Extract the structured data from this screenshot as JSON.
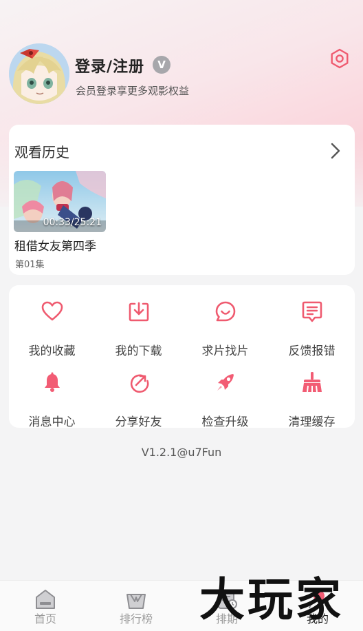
{
  "profile": {
    "user_name": "登录/注册",
    "vip_badge": "V",
    "subtitle": "会员登录享更多观影权益"
  },
  "history": {
    "title": "观看历史",
    "items": [
      {
        "title": "租借女友第四季",
        "episode": "第01集",
        "progress": "00:33/25:21"
      }
    ]
  },
  "menu": {
    "items": [
      {
        "label": "我的收藏",
        "icon": "heart-icon"
      },
      {
        "label": "我的下载",
        "icon": "download-icon"
      },
      {
        "label": "求片找片",
        "icon": "smile-chat-icon"
      },
      {
        "label": "反馈报错",
        "icon": "feedback-icon"
      },
      {
        "label": "消息中心",
        "icon": "bell-icon"
      },
      {
        "label": "分享好友",
        "icon": "share-icon"
      },
      {
        "label": "检查升级",
        "icon": "rocket-icon"
      },
      {
        "label": "清理缓存",
        "icon": "broom-icon"
      }
    ]
  },
  "version": "V1.2.1@u7Fun",
  "tabbar": {
    "tabs": [
      {
        "label": "首页",
        "icon": "home-icon"
      },
      {
        "label": "排行榜",
        "icon": "ranking-icon"
      },
      {
        "label": "排期",
        "icon": "schedule-icon"
      },
      {
        "label": "我的",
        "icon": "profile-icon",
        "active": true
      }
    ]
  },
  "watermark": "大玩家",
  "colors": {
    "accent": "#ef5a6f",
    "icon_pink": "#f25c74",
    "header_gradient_end": "#fbc9d2"
  }
}
